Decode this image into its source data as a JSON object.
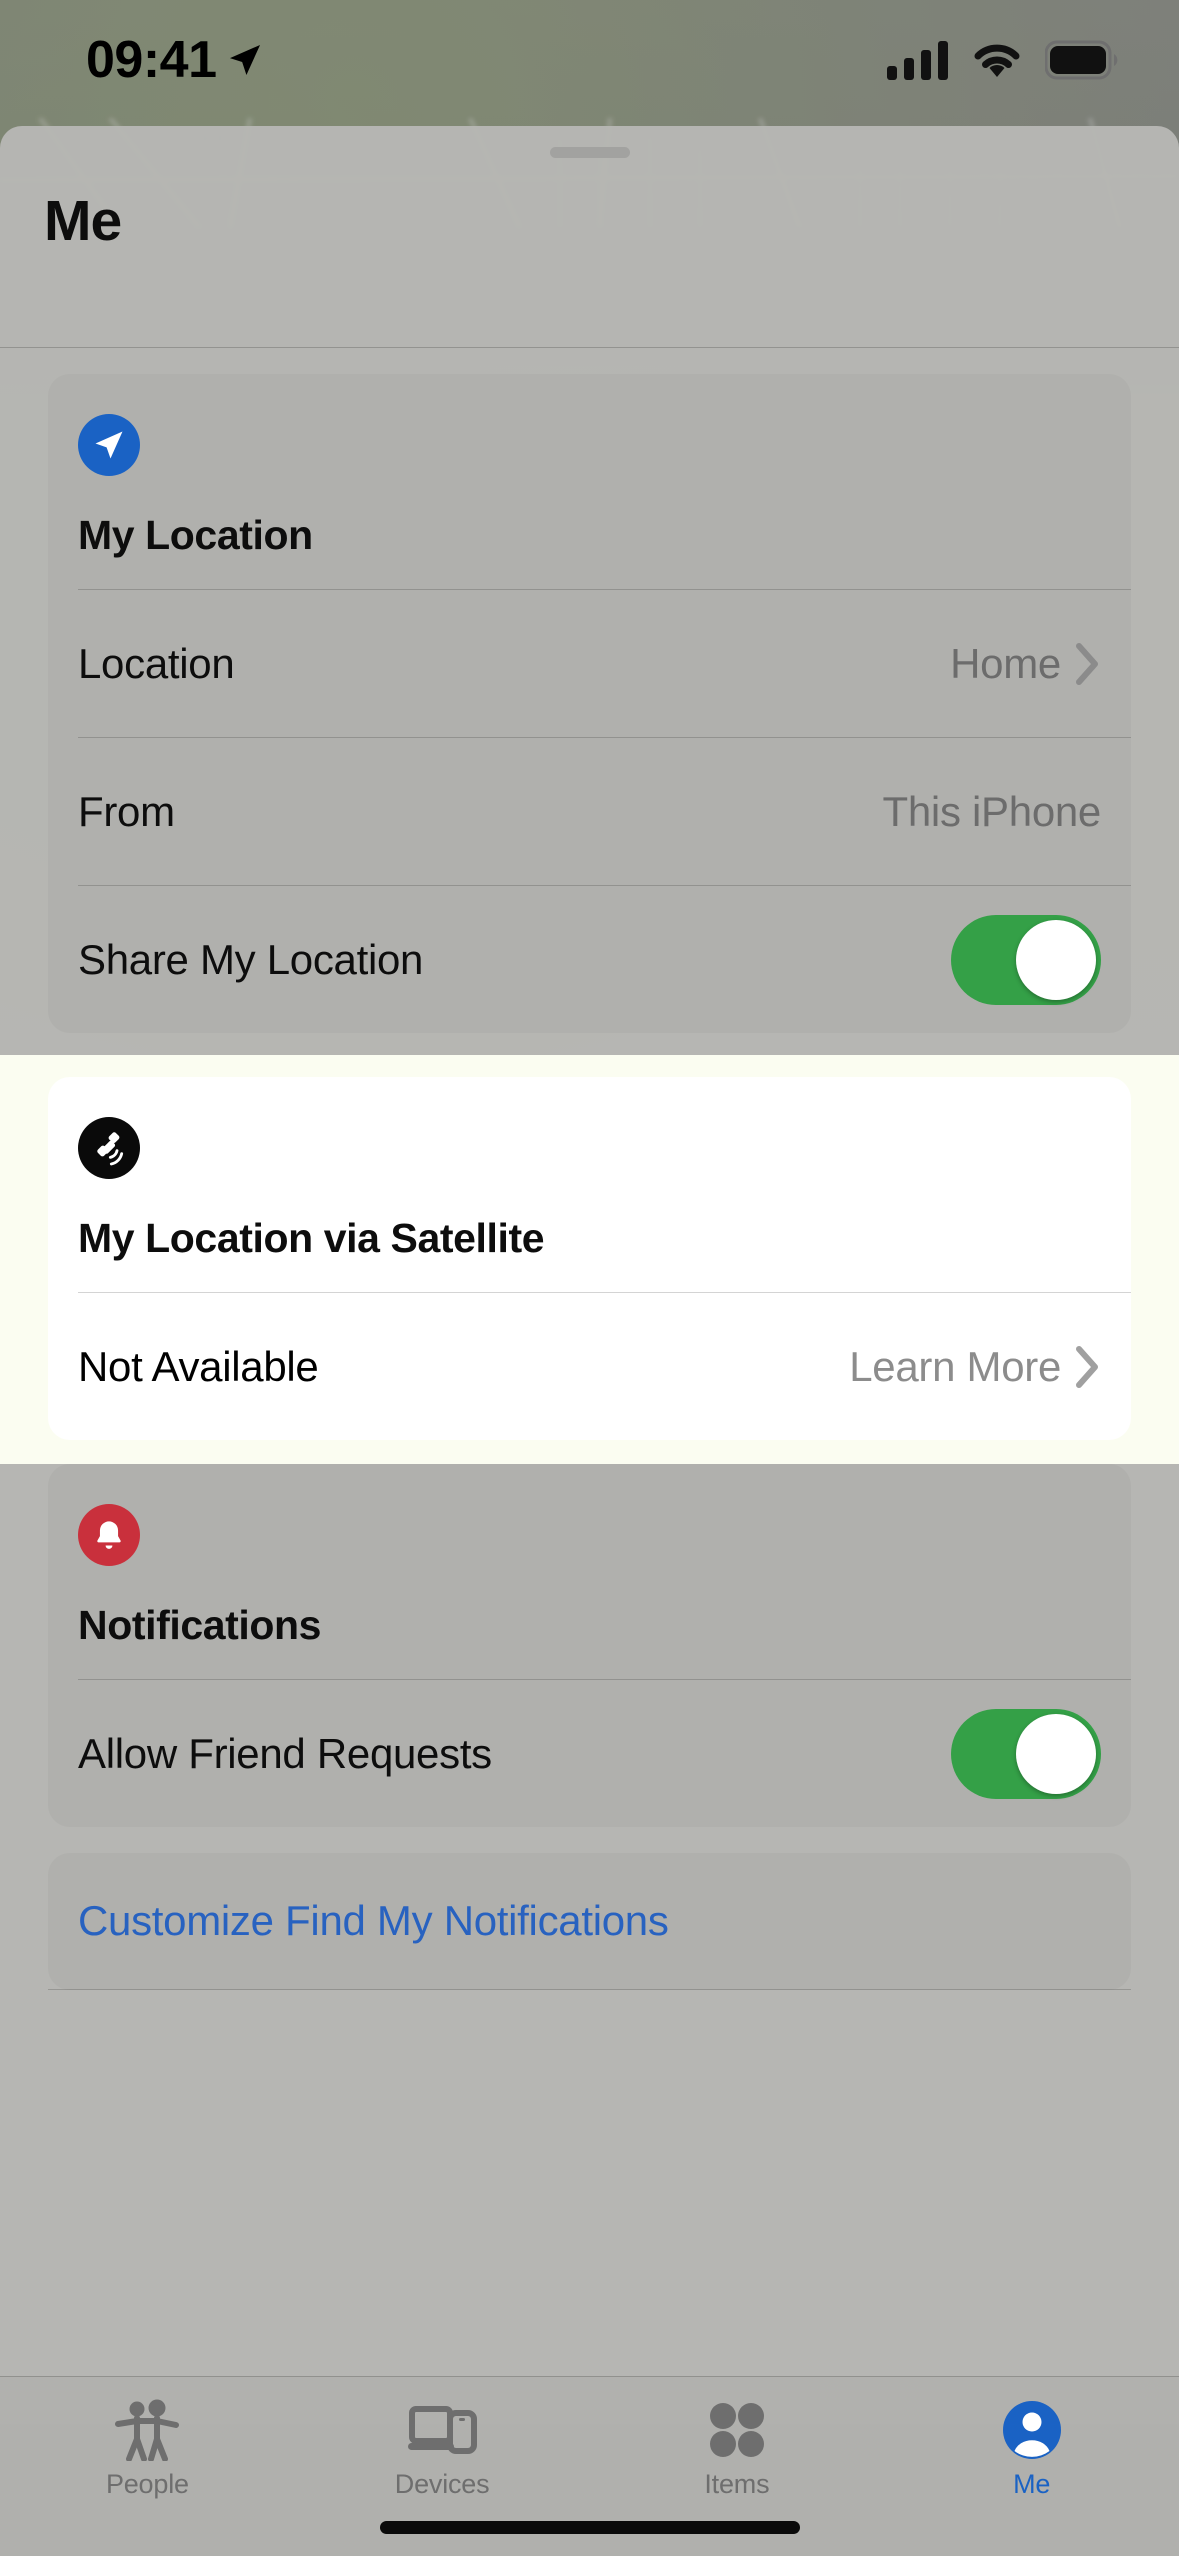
{
  "status_bar": {
    "time": "09:41",
    "location_arrow_icon": "location-arrow-icon",
    "cellular_icon": "cellular-signal-icon",
    "wifi_icon": "wifi-icon",
    "battery_icon": "battery-full-icon"
  },
  "sheet": {
    "title": "Me",
    "grab_handle": "sheet-grab-handle"
  },
  "my_location_card": {
    "icon": "location-arrow-icon",
    "title": "My Location",
    "rows": [
      {
        "label": "Location",
        "value": "Home",
        "chevron": true
      },
      {
        "label": "From",
        "value": "This iPhone",
        "chevron": false
      }
    ],
    "toggle_row": {
      "label": "Share My Location",
      "state": "on"
    }
  },
  "satellite_card": {
    "icon": "satellite-icon",
    "title": "My Location via Satellite",
    "row": {
      "label": "Not Available",
      "value": "Learn More",
      "chevron": true
    }
  },
  "notifications_card": {
    "icon": "bell-icon",
    "title": "Notifications",
    "toggle_row": {
      "label": "Allow Friend Requests",
      "state": "on"
    }
  },
  "customize_card": {
    "link_label": "Customize Find My Notifications"
  },
  "tab_bar": {
    "tabs": [
      {
        "label": "People",
        "icon": "people-icon",
        "active": false
      },
      {
        "label": "Devices",
        "icon": "devices-icon",
        "active": false
      },
      {
        "label": "Items",
        "icon": "items-icon",
        "active": false
      },
      {
        "label": "Me",
        "icon": "person-circle-icon",
        "active": true
      }
    ]
  },
  "colors": {
    "accent_blue": "#1a62c4",
    "toggle_green": "#34a047",
    "notification_red": "#c9303c",
    "link_blue": "#2862c0",
    "satellite_black": "#0a0a0a"
  }
}
